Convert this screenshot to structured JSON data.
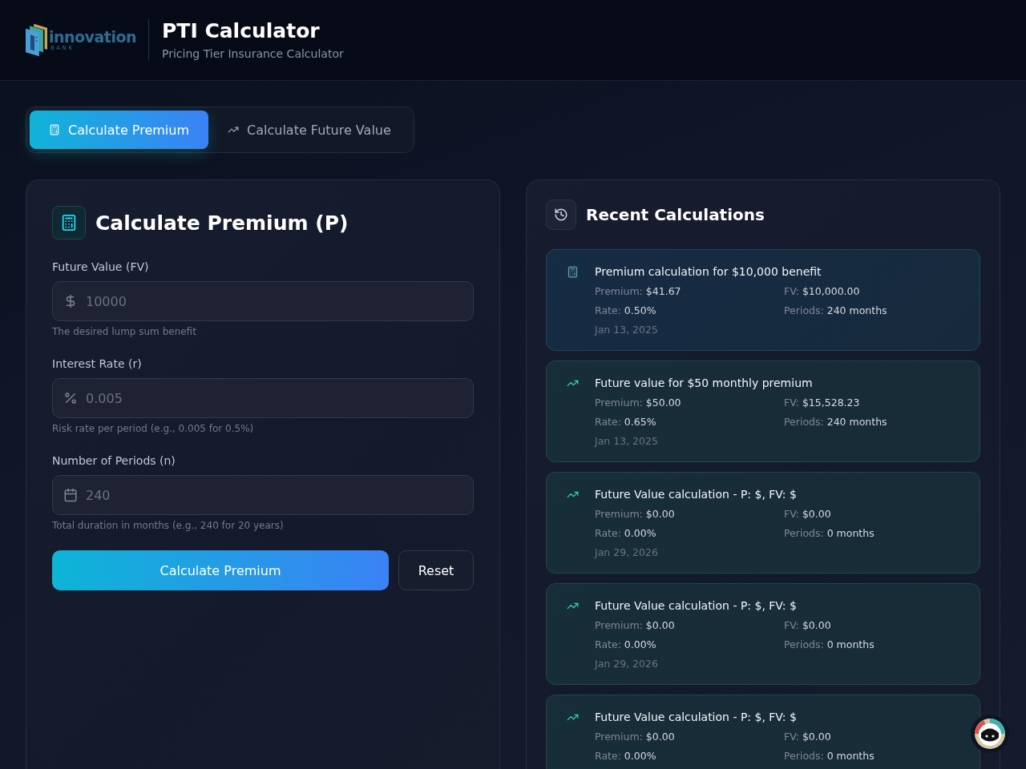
{
  "header": {
    "logo": {
      "wordmark": "innovation",
      "tagline": "BANK"
    },
    "title": "PTI Calculator",
    "subtitle": "Pricing Tier Insurance Calculator"
  },
  "tabs": [
    {
      "label": "Calculate Premium",
      "kind": "calculator",
      "selected": true
    },
    {
      "label": "Calculate Future Value",
      "kind": "trend",
      "selected": false
    }
  ],
  "calculator": {
    "title": "Calculate Premium (P)",
    "fields": [
      {
        "label": "Future Value (FV)",
        "kind": "currency",
        "placeholder": "10000",
        "hint": "The desired lump sum benefit"
      },
      {
        "label": "Interest Rate (r)",
        "kind": "percent",
        "placeholder": "0.005",
        "hint": "Risk rate per period (e.g., 0.005 for 0.5%)"
      },
      {
        "label": "Number of Periods (n)",
        "kind": "calendar",
        "placeholder": "240",
        "hint": "Total duration in months (e.g., 240 for 20 years)"
      }
    ],
    "buttons": [
      {
        "label": "Calculate Premium",
        "kind": "primary"
      },
      {
        "label": "Reset",
        "kind": "secondary"
      }
    ]
  },
  "recent": {
    "title": "Recent Calculations",
    "items": [
      {
        "kind": "premium",
        "title": "Premium calculation for $10,000 benefit",
        "details": [
          {
            "label": "Premium:",
            "value": "$41.67"
          },
          {
            "label": "FV:",
            "value": "$10,000.00"
          },
          {
            "label": "Rate:",
            "value": "0.50%"
          },
          {
            "label": "Periods:",
            "value": "240 months"
          }
        ],
        "date": "Jan 13, 2025"
      },
      {
        "kind": "future_value",
        "title": "Future value for $50 monthly premium",
        "details": [
          {
            "label": "Premium:",
            "value": "$50.00"
          },
          {
            "label": "FV:",
            "value": "$15,528.23"
          },
          {
            "label": "Rate:",
            "value": "0.65%"
          },
          {
            "label": "Periods:",
            "value": "240 months"
          }
        ],
        "date": "Jan 13, 2025"
      },
      {
        "kind": "future_value",
        "title": "Future Value calculation - P: $, FV: $",
        "details": [
          {
            "label": "Premium:",
            "value": "$0.00"
          },
          {
            "label": "FV:",
            "value": "$0.00"
          },
          {
            "label": "Rate:",
            "value": "0.00%"
          },
          {
            "label": "Periods:",
            "value": "0 months"
          }
        ],
        "date": "Jan 29, 2026"
      },
      {
        "kind": "future_value",
        "title": "Future Value calculation - P: $, FV: $",
        "details": [
          {
            "label": "Premium:",
            "value": "$0.00"
          },
          {
            "label": "FV:",
            "value": "$0.00"
          },
          {
            "label": "Rate:",
            "value": "0.00%"
          },
          {
            "label": "Periods:",
            "value": "0 months"
          }
        ],
        "date": "Jan 29, 2026"
      },
      {
        "kind": "future_value",
        "title": "Future Value calculation - P: $, FV: $",
        "details": [
          {
            "label": "Premium:",
            "value": "$0.00"
          },
          {
            "label": "FV:",
            "value": "$0.00"
          },
          {
            "label": "Rate:",
            "value": "0.00%"
          },
          {
            "label": "Periods:",
            "value": "0 months"
          }
        ]
      }
    ]
  }
}
